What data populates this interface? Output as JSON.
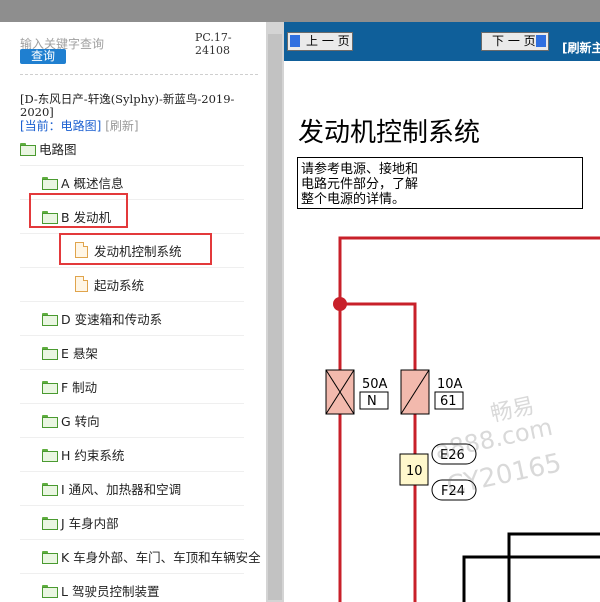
{
  "search": {
    "placeholder": "输入关键字查询",
    "button": "查询"
  },
  "pc_code": "PC.17-24108",
  "vehicle": "[D-东风日产-轩逸(Sylphy)-新蓝鸟-2019-2020]",
  "current": {
    "label": "[当前：电路图]",
    "refresh": "[刷新]"
  },
  "tree": {
    "root": "电路图",
    "items": [
      {
        "label": "A 概述信息"
      },
      {
        "label": "B 发动机"
      },
      {
        "label": "发动机控制系统"
      },
      {
        "label": "起动系统"
      },
      {
        "label": "D 变速箱和传动系"
      },
      {
        "label": "E 悬架"
      },
      {
        "label": "F 制动"
      },
      {
        "label": "G 转向"
      },
      {
        "label": "H 约束系统"
      },
      {
        "label": "I 通风、加热器和空调"
      },
      {
        "label": "J 车身内部"
      },
      {
        "label": "K 车身外部、车门、车顶和车辆安全"
      },
      {
        "label": "L 驾驶员控制装置"
      }
    ]
  },
  "nav": {
    "prev": "上 一 页",
    "next": "下 一 页",
    "refresh": "[刷新主"
  },
  "doc": {
    "title": "发动机控制系统",
    "note": [
      "请参考电源、接地和",
      "电路元件部分，了解",
      "整个电源的详情。"
    ]
  },
  "diagram": {
    "fuse1": {
      "amp": "50A",
      "code": "N"
    },
    "fuse2": {
      "amp": "10A",
      "code": "61"
    },
    "relay_num": "10",
    "connectors": [
      "E26",
      "F24"
    ],
    "wire_color": "#c8202a"
  },
  "watermark": {
    "line1": "畅易",
    "line2": "a888.com",
    "line3": "CY20165"
  }
}
